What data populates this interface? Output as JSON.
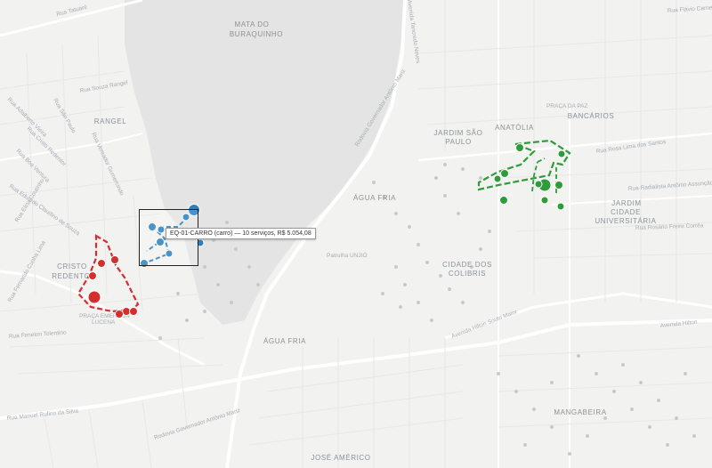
{
  "map": {
    "neighborhoods": [
      {
        "name": "MATA DO",
        "name2": "BURAQUINHO"
      },
      {
        "name": "RANGEL"
      },
      {
        "name": "CRISTO",
        "name2": "REDENTOR"
      },
      {
        "name": "JARDIM SÃO",
        "name2": "PAULO"
      },
      {
        "name": "ANATÓLIA"
      },
      {
        "name": "BANCÁRIOS"
      },
      {
        "name": "ÁGUA FRIA"
      },
      {
        "name": "JARDIM",
        "name2": "CIDADE",
        "name3": "UNIVERSITÁRIA"
      },
      {
        "name": "CIDADE DOS",
        "name2": "COLIBRIS"
      },
      {
        "name": "ÁGUA FRIA"
      },
      {
        "name": "MANGABEIRA"
      },
      {
        "name": "JOSÉ AMÉRICO"
      }
    ],
    "small_labels": [
      {
        "text": "PRAÇA DA PAZ"
      },
      {
        "text": "PRAÇA EMERSON"
      },
      {
        "text": "LUCENA"
      },
      {
        "text": "Patrulha UNJIÓ"
      }
    ],
    "streets": [
      {
        "text": "Rua Tatuaré"
      },
      {
        "text": "Rua Souza Rangel"
      },
      {
        "text": "Rua Rosa Lima dos Santos"
      },
      {
        "text": "Rua Radialista Antônio Assunção"
      },
      {
        "text": "Rua Rosário Freire Corrêa"
      },
      {
        "text": "Avenida Hilton Souto Maior"
      },
      {
        "text": "Avenida Hilton"
      },
      {
        "text": "Rodovia Governador Antônio Mariz"
      },
      {
        "text": "Rodovia Governador Antônio Mariz"
      },
      {
        "text": "Rua Manoel Rufino da Silva"
      },
      {
        "text": "Avenida Tancredo Neves"
      },
      {
        "text": "Rua Vereador Gumercindo"
      },
      {
        "text": "Rua Adalberto Vieira"
      },
      {
        "text": "Rua Cristo Redentor"
      },
      {
        "text": "Rua Boa Ventura"
      },
      {
        "text": "Rua São Paulo"
      },
      {
        "text": "Rua Eduardo Claudino de Souza"
      },
      {
        "text": "Rua Fernando Cunha Lima"
      },
      {
        "text": "Rua Fenelon Tolentino"
      },
      {
        "text": "Rua Elina Coutinho"
      },
      {
        "text": "Rua Flávio Carneiro Ribeiro"
      }
    ],
    "tooltip": {
      "text": "EQ-01-CARRO (carro) — 10 serviços, R$ 5.054,08"
    },
    "teams": [
      {
        "id": "red",
        "color": "#d32f2f"
      },
      {
        "id": "blue",
        "color": "#2c7fc0"
      },
      {
        "id": "green",
        "color": "#2f9b3a"
      }
    ]
  }
}
